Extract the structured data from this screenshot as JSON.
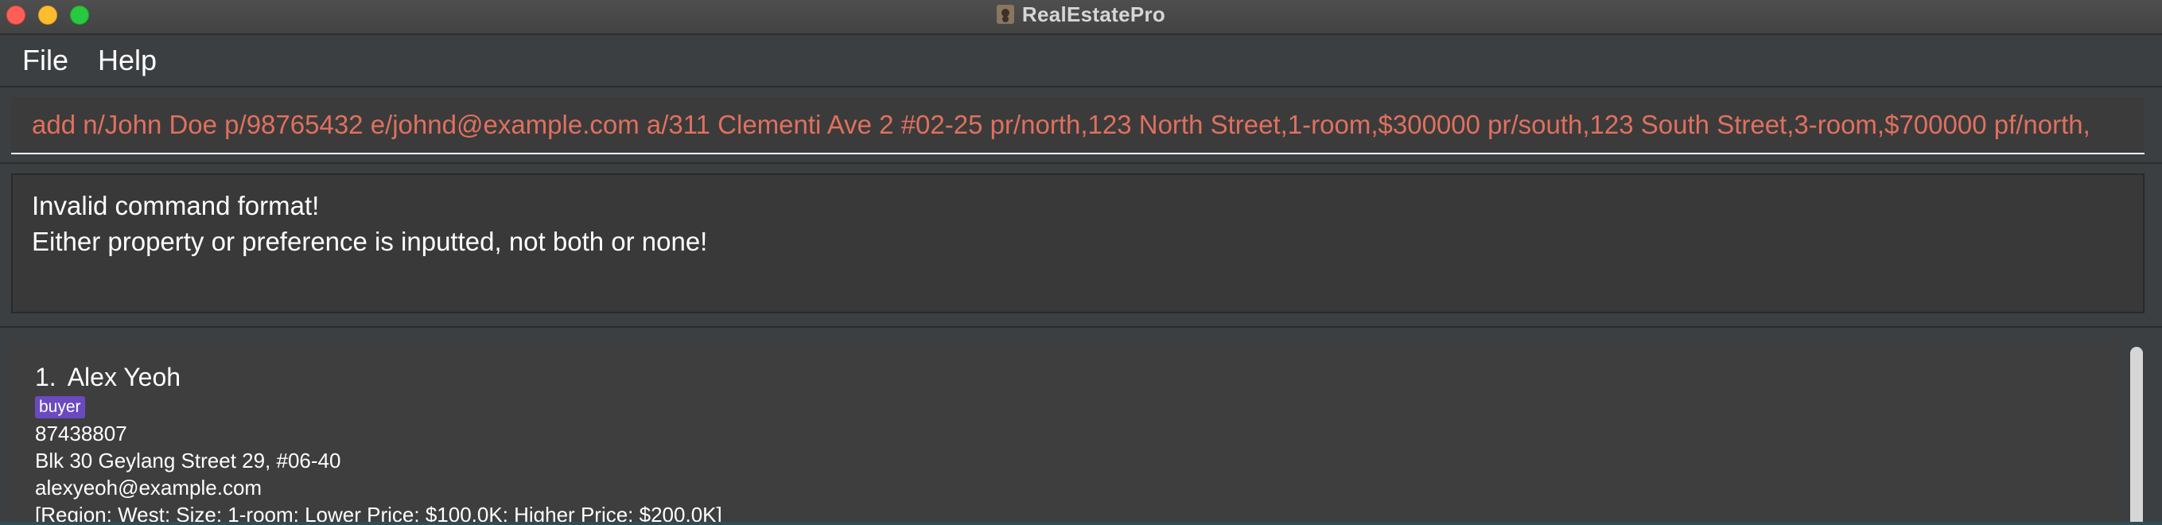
{
  "window": {
    "title": "RealEstatePro",
    "app_icon": "person-book-icon"
  },
  "menu": {
    "items": [
      {
        "label": "File"
      },
      {
        "label": "Help"
      }
    ]
  },
  "command_box": {
    "value": "add n/John Doe p/98765432 e/johnd@example.com a/311 Clementi Ave 2 #02-25 pr/north,123 North Street,1-room,$300000 pr/south,123 South Street,3-room,$700000 pf/north,",
    "text_color": "#e0705e"
  },
  "result_display": {
    "lines": [
      "Invalid command format!",
      "Either property or preference is inputted, not both or none!"
    ]
  },
  "person_list": {
    "persons": [
      {
        "index": "1.",
        "name": "Alex Yeoh",
        "tags": [
          "buyer"
        ],
        "phone": "87438807",
        "address": "Blk 30 Geylang Street 29, #06-40",
        "email": "alexyeoh@example.com",
        "preference": "[Region: West; Size: 1-room; Lower Price: $100.0K; Higher Price: $200.0K]"
      }
    ]
  },
  "colors": {
    "background": "#3c3f41",
    "tag": "#6a4ac0",
    "close": "#ff5f57",
    "minimize": "#febc2e",
    "maximize": "#28c840"
  }
}
